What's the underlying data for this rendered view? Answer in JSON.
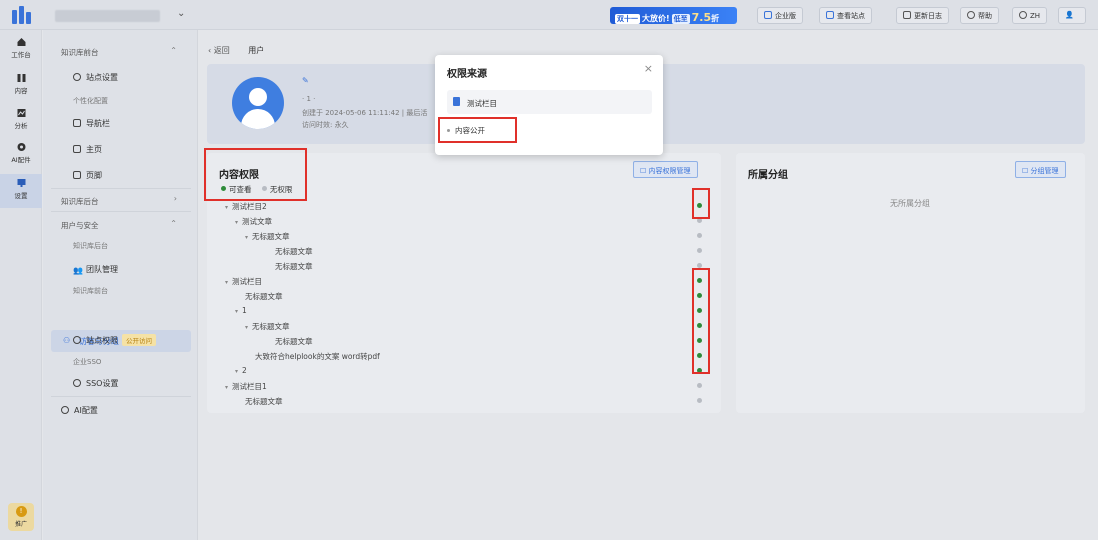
{
  "topbar": {
    "promo": {
      "tag": "双十一",
      "text": "大放价!",
      "tag2": "低至",
      "big": "7.5",
      "suffix": "折"
    },
    "buttons": [
      "企业版",
      "查看站点",
      "更新日志",
      "帮助",
      "ZH"
    ]
  },
  "rail": {
    "items": [
      "工作台",
      "内容",
      "分析",
      "AI配件",
      "设置"
    ],
    "promo_label": "推广"
  },
  "sidebar": {
    "group1": "知识库前台",
    "g1_items": [
      "站点设置",
      "个性化配置",
      "导航栏",
      "主页",
      "页脚"
    ],
    "group2": "知识库后台",
    "group3": "用户与安全",
    "g3_items": [
      "知识库后台",
      "团队管理",
      "知识库前台",
      "访客与分组",
      "站点权限",
      "企业SSO",
      "SSO设置"
    ],
    "badge": "公开访问",
    "ai": "AI配置"
  },
  "breadcrumb": {
    "back": "返回",
    "title": "用户"
  },
  "profile": {
    "line1": "· 1 ·",
    "line2": "创建于 2024-05-06 11:11:42  |  最后活",
    "line3": "访问时效: 永久"
  },
  "permissions": {
    "title": "内容权限",
    "legend_view": "可查看",
    "legend_none": "无权限",
    "manage_btn": "内容权限管理",
    "colors": {
      "view": "#2e8b3a",
      "none": "#b8bcc3"
    },
    "tree": [
      {
        "label": "测试栏目2",
        "indent": 0,
        "arrow": true,
        "access": "view"
      },
      {
        "label": "测试文章",
        "indent": 1,
        "arrow": true,
        "access": "none"
      },
      {
        "label": "无标题文章",
        "indent": 2,
        "arrow": true,
        "access": "none"
      },
      {
        "label": "无标题文章",
        "indent": 3,
        "arrow": false,
        "access": "none"
      },
      {
        "label": "无标题文章",
        "indent": 3,
        "arrow": false,
        "access": "none"
      },
      {
        "label": "测试栏目",
        "indent": 0,
        "arrow": true,
        "access": "view"
      },
      {
        "label": "无标题文章",
        "indent": 1,
        "arrow": false,
        "access": "view"
      },
      {
        "label": "1",
        "indent": 1,
        "arrow": true,
        "access": "view"
      },
      {
        "label": "无标题文章",
        "indent": 2,
        "arrow": true,
        "access": "view"
      },
      {
        "label": "无标题文章",
        "indent": 3,
        "arrow": false,
        "access": "view"
      },
      {
        "label": "大致符合helplook的文案 word转pdf",
        "indent": 2,
        "arrow": false,
        "access": "view"
      },
      {
        "label": "2",
        "indent": 1,
        "arrow": true,
        "access": "view"
      },
      {
        "label": "测试栏目1",
        "indent": 0,
        "arrow": true,
        "access": "none"
      },
      {
        "label": "无标题文章",
        "indent": 1,
        "arrow": false,
        "access": "none"
      }
    ]
  },
  "groups": {
    "title": "所属分组",
    "manage_btn": "分组管理",
    "empty": "无所属分组"
  },
  "modal": {
    "title": "权限来源",
    "close": "×",
    "source": "测试栏目",
    "item": "内容公开"
  }
}
